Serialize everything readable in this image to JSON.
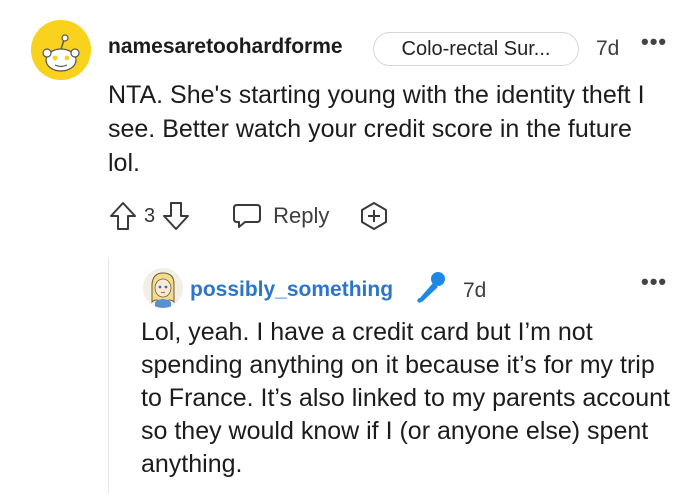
{
  "comment1": {
    "username": "namesaretoohardforme",
    "flair": "Colo-rectal Sur...",
    "timestamp": "7d",
    "body": "NTA. She's starting young with the identity theft I see. Better watch your credit score in the future lol.",
    "votes": "3",
    "reply_label": "Reply",
    "more_label": "•••"
  },
  "comment2": {
    "username": "possibly_something",
    "timestamp": "7d",
    "body": "Lol, yeah. I have a credit card but I’m not spending anything on it because it’s for my trip to France. It’s also linked to my parents account so they would know if I (or anyone else) spent anything.",
    "more_label": "•••",
    "name_color": "#2b76c9"
  },
  "icons": {
    "upvote": "upvote-arrow-icon",
    "downvote": "downvote-arrow-icon",
    "reply": "speech-bubble-icon",
    "award": "award-plus-icon",
    "mic": "microphone-icon",
    "more": "more-dots-icon"
  },
  "colors": {
    "avatar1_bg": "#f8d21d",
    "mic": "#1e88e5"
  }
}
